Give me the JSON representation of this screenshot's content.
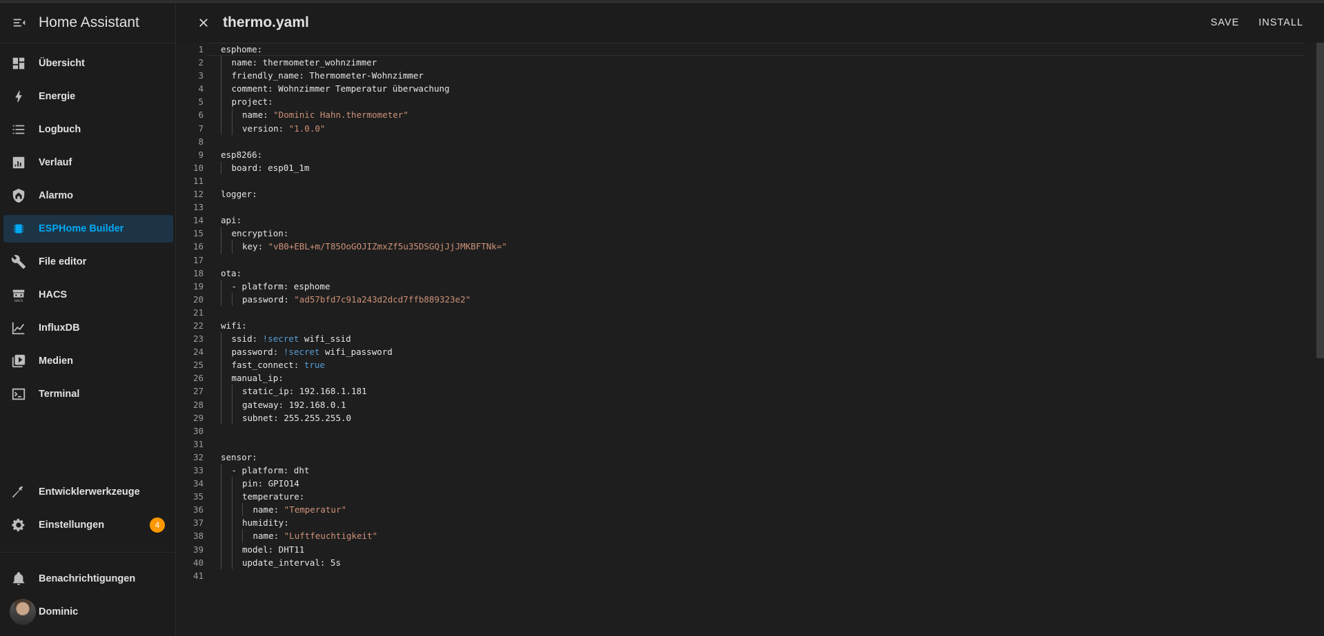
{
  "app": {
    "title": "Home Assistant"
  },
  "sidebar": {
    "items": [
      {
        "label": "Übersicht",
        "icon": "dashboard-icon"
      },
      {
        "label": "Energie",
        "icon": "lightning-icon"
      },
      {
        "label": "Logbuch",
        "icon": "list-icon"
      },
      {
        "label": "Verlauf",
        "icon": "chart-bar-icon"
      },
      {
        "label": "Alarmo",
        "icon": "shield-home-icon"
      },
      {
        "label": "ESPHome Builder",
        "icon": "chip-icon",
        "active": true
      },
      {
        "label": "File editor",
        "icon": "wrench-icon"
      },
      {
        "label": "HACS",
        "icon": "hacs-icon"
      },
      {
        "label": "InfluxDB",
        "icon": "chart-area-icon"
      },
      {
        "label": "Medien",
        "icon": "media-icon"
      },
      {
        "label": "Terminal",
        "icon": "console-icon"
      }
    ],
    "dev_tools": {
      "label": "Entwicklerwerkzeuge",
      "icon": "hammer-icon"
    },
    "settings": {
      "label": "Einstellungen",
      "icon": "cog-icon",
      "badge": "4"
    },
    "notifications": {
      "label": "Benachrichtigungen",
      "icon": "bell-icon"
    },
    "user": {
      "label": "Dominic"
    }
  },
  "toolbar": {
    "file_name": "thermo.yaml",
    "save_label": "SAVE",
    "install_label": "INSTALL"
  },
  "colors": {
    "accent": "#03a9f4",
    "badge": "#ff9800",
    "string": "#ce9178",
    "keyword": "#569cd6"
  },
  "editor": {
    "lines": [
      "esphome:",
      "  name: thermometer_wohnzimmer",
      "  friendly_name: Thermometer-Wohnzimmer",
      "  comment: Wohnzimmer Temperatur überwachung",
      "  project:",
      "    name: \"Dominic Hahn.thermometer\"",
      "    version: \"1.0.0\"",
      "",
      "esp8266:",
      "  board: esp01_1m",
      "",
      "logger:",
      "",
      "api:",
      "  encryption:",
      "    key: \"vB0+EBL+m/T85OoGOJIZmxZf5u35DSGQjJjJMKBFTNk=\"",
      "",
      "ota:",
      "  - platform: esphome",
      "    password: \"ad57bfd7c91a243d2dcd7ffb889323e2\"",
      "",
      "wifi:",
      "  ssid: !secret wifi_ssid",
      "  password: !secret wifi_password",
      "  fast_connect: true",
      "  manual_ip:",
      "    static_ip: 192.168.1.181",
      "    gateway: 192.168.0.1",
      "    subnet: 255.255.255.0",
      "",
      "",
      "sensor:",
      "  - platform: dht",
      "    pin: GPIO14",
      "    temperature:",
      "      name: \"Temperatur\"",
      "    humidity:",
      "      name: \"Luftfeuchtigkeit\"",
      "    model: DHT11",
      "    update_interval: 5s",
      ""
    ]
  }
}
